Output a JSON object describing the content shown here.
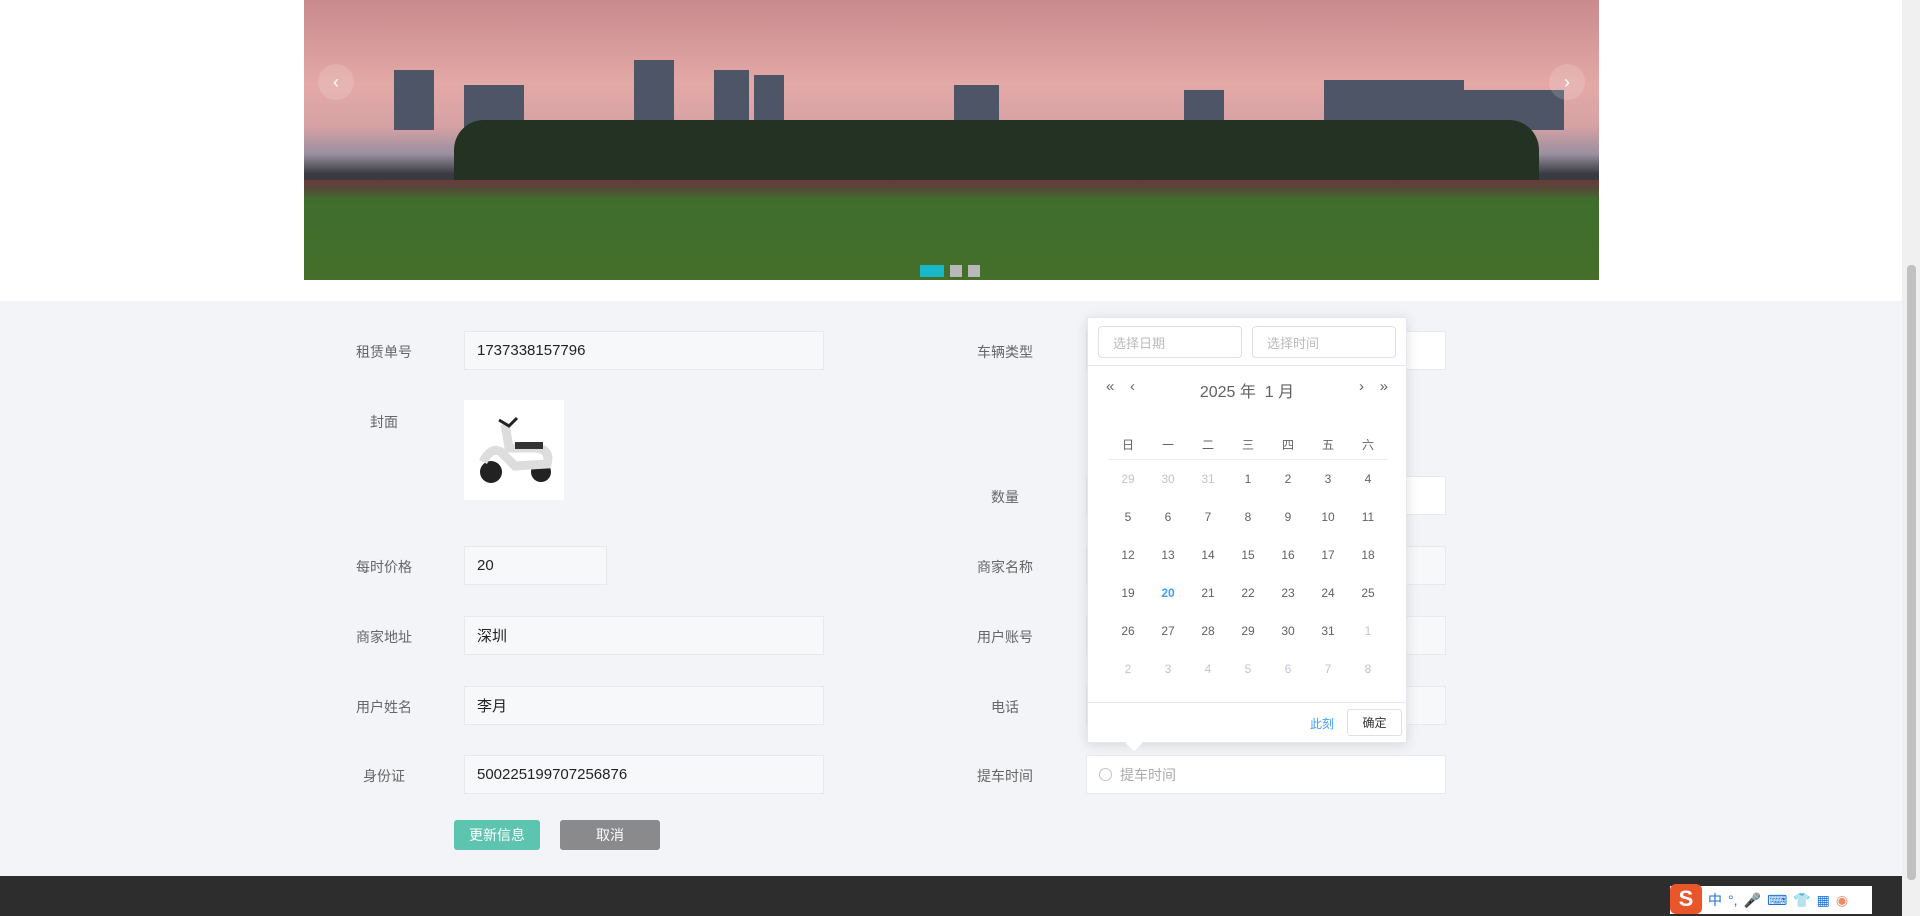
{
  "carousel": {
    "prev": "‹",
    "next": "›",
    "slides": 3,
    "active_index": 0,
    "active_color": "#19b8c8"
  },
  "form": {
    "order_no": {
      "label": "租赁单号",
      "value": "1737338157796"
    },
    "cover": {
      "label": "封面"
    },
    "price": {
      "label": "每时价格",
      "value": "20"
    },
    "merchant_address": {
      "label": "商家地址",
      "value": "深圳"
    },
    "user_name": {
      "label": "用户姓名",
      "value": "李月"
    },
    "id_card": {
      "label": "身份证",
      "value": "500225199707256876"
    },
    "vehicle_type": {
      "label": "车辆类型",
      "value": ""
    },
    "quantity": {
      "label": "数量",
      "value": ""
    },
    "merchant_name": {
      "label": "商家名称",
      "value": ""
    },
    "user_account": {
      "label": "用户账号",
      "value": ""
    },
    "phone": {
      "label": "电话",
      "value": ""
    },
    "pickup_time": {
      "label": "提车时间",
      "placeholder": "提车时间"
    },
    "update_button": "更新信息",
    "cancel_button": "取消",
    "accent": "#5cc4af"
  },
  "datepicker": {
    "date_placeholder": "选择日期",
    "time_placeholder": "选择时间",
    "title": "2025 年  1 月",
    "weekdays": [
      "日",
      "一",
      "二",
      "三",
      "四",
      "五",
      "六"
    ],
    "weeks": [
      [
        "29",
        "30",
        "31",
        "1",
        "2",
        "3",
        "4"
      ],
      [
        "5",
        "6",
        "7",
        "8",
        "9",
        "10",
        "11"
      ],
      [
        "12",
        "13",
        "14",
        "15",
        "16",
        "17",
        "18"
      ],
      [
        "19",
        "20",
        "21",
        "22",
        "23",
        "24",
        "25"
      ],
      [
        "26",
        "27",
        "28",
        "29",
        "30",
        "31",
        "1"
      ],
      [
        "2",
        "3",
        "4",
        "5",
        "6",
        "7",
        "8"
      ]
    ],
    "today": "20",
    "now_button": "此刻",
    "confirm_button": "确定",
    "highlight_color": "#409eff"
  },
  "tray": {
    "ime": "中",
    "punct": "°,"
  }
}
